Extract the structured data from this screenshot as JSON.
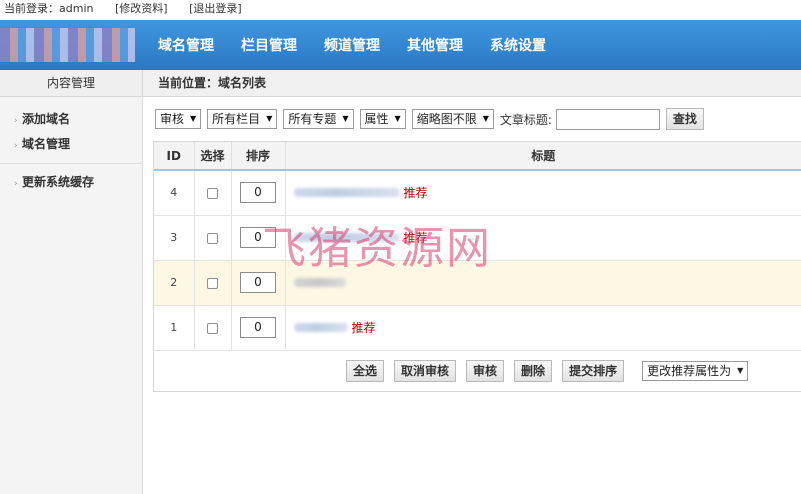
{
  "topbar": {
    "login_text": "当前登录：admin",
    "edit_profile": "[修改资料]",
    "logout": "[退出登录]"
  },
  "nav": {
    "items": [
      "域名管理",
      "栏目管理",
      "频道管理",
      "其他管理",
      "系统设置"
    ]
  },
  "sidebar": {
    "title": "内容管理",
    "items": [
      "添加域名",
      "域名管理"
    ],
    "extra": "更新系统缓存"
  },
  "breadcrumb": "当前位置：域名列表",
  "filters": {
    "audit": "审核",
    "category": "所有栏目",
    "topic": "所有专题",
    "attribute": "属性",
    "thumbnail": "缩略图不限",
    "title_label": "文章标题:",
    "title_placeholder": "",
    "search_button": "查找"
  },
  "table": {
    "headers": [
      "ID",
      "选择",
      "排序",
      "标题"
    ],
    "rows": [
      {
        "id": "4",
        "order": "0",
        "tag": "推荐"
      },
      {
        "id": "3",
        "order": "0",
        "tag": "推荐"
      },
      {
        "id": "2",
        "order": "0",
        "tag": ""
      },
      {
        "id": "1",
        "order": "0",
        "tag": "推荐"
      }
    ]
  },
  "actions": {
    "select_all": "全选",
    "cancel_audit": "取消审核",
    "audit": "审核",
    "delete": "删除",
    "submit_order": "提交排序",
    "change_attr": "更改推荐属性为"
  },
  "watermark": "飞猪资源网"
}
